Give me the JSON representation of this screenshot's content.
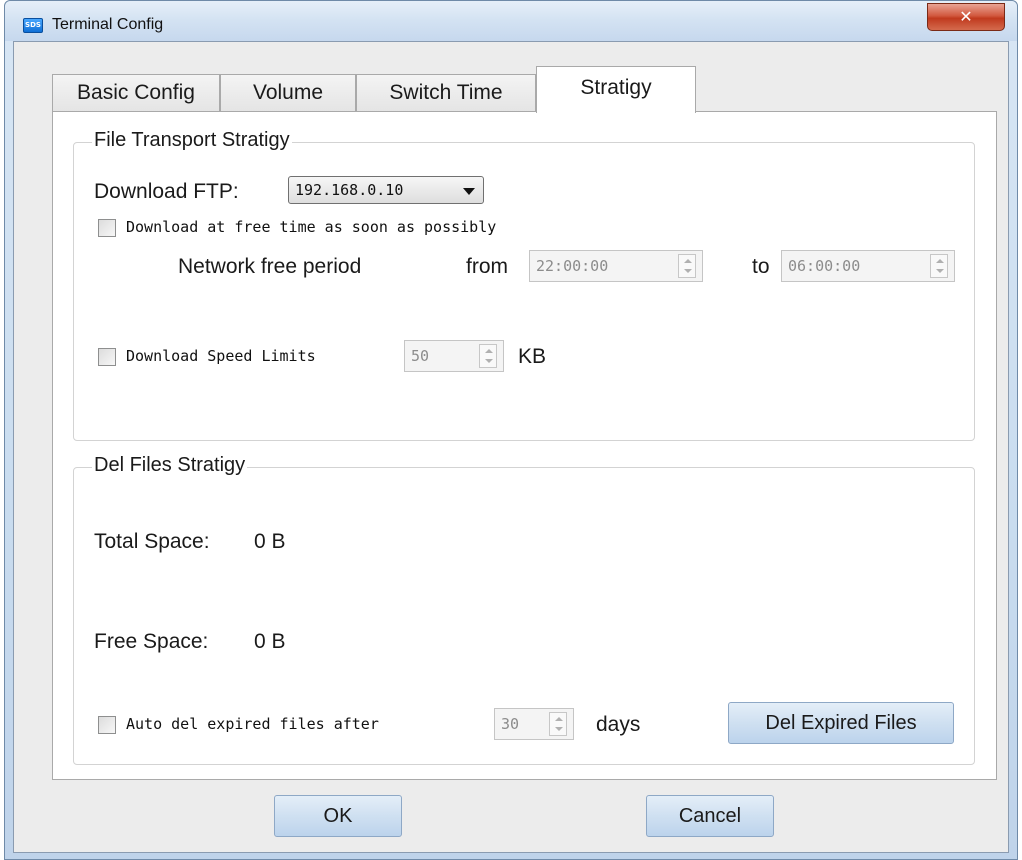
{
  "window": {
    "title": "Terminal Config",
    "app_icon_text": "SDS",
    "close_glyph": "✕"
  },
  "tabs": [
    {
      "label": "Basic Config",
      "active": false
    },
    {
      "label": "Volume",
      "active": false
    },
    {
      "label": "Switch Time",
      "active": false
    },
    {
      "label": "Stratigy",
      "active": true
    }
  ],
  "file_transport": {
    "title": "File Transport Stratigy",
    "download_ftp_label": "Download FTP:",
    "download_ftp_value": "192.168.0.10",
    "free_time_checkbox_label": "Download at free time as soon as possibly",
    "free_time_checked": false,
    "network_free_period_label": "Network free period",
    "from_label": "from",
    "from_value": "22:00:00",
    "to_label": "to",
    "to_value": "06:00:00",
    "speed_limit_checkbox_label": "Download Speed Limits",
    "speed_limit_checked": false,
    "speed_limit_value": "50",
    "speed_limit_unit": "KB"
  },
  "del_files": {
    "title": "Del Files Stratigy",
    "total_space_label": "Total Space:",
    "total_space_value": "0 B",
    "free_space_label": "Free Space:",
    "free_space_value": "0 B",
    "auto_del_checkbox_label": "Auto del expired files after",
    "auto_del_checked": false,
    "auto_del_days_value": "30",
    "days_label": "days",
    "del_expired_button": "Del Expired Files"
  },
  "footer": {
    "ok_label": "OK",
    "cancel_label": "Cancel"
  }
}
